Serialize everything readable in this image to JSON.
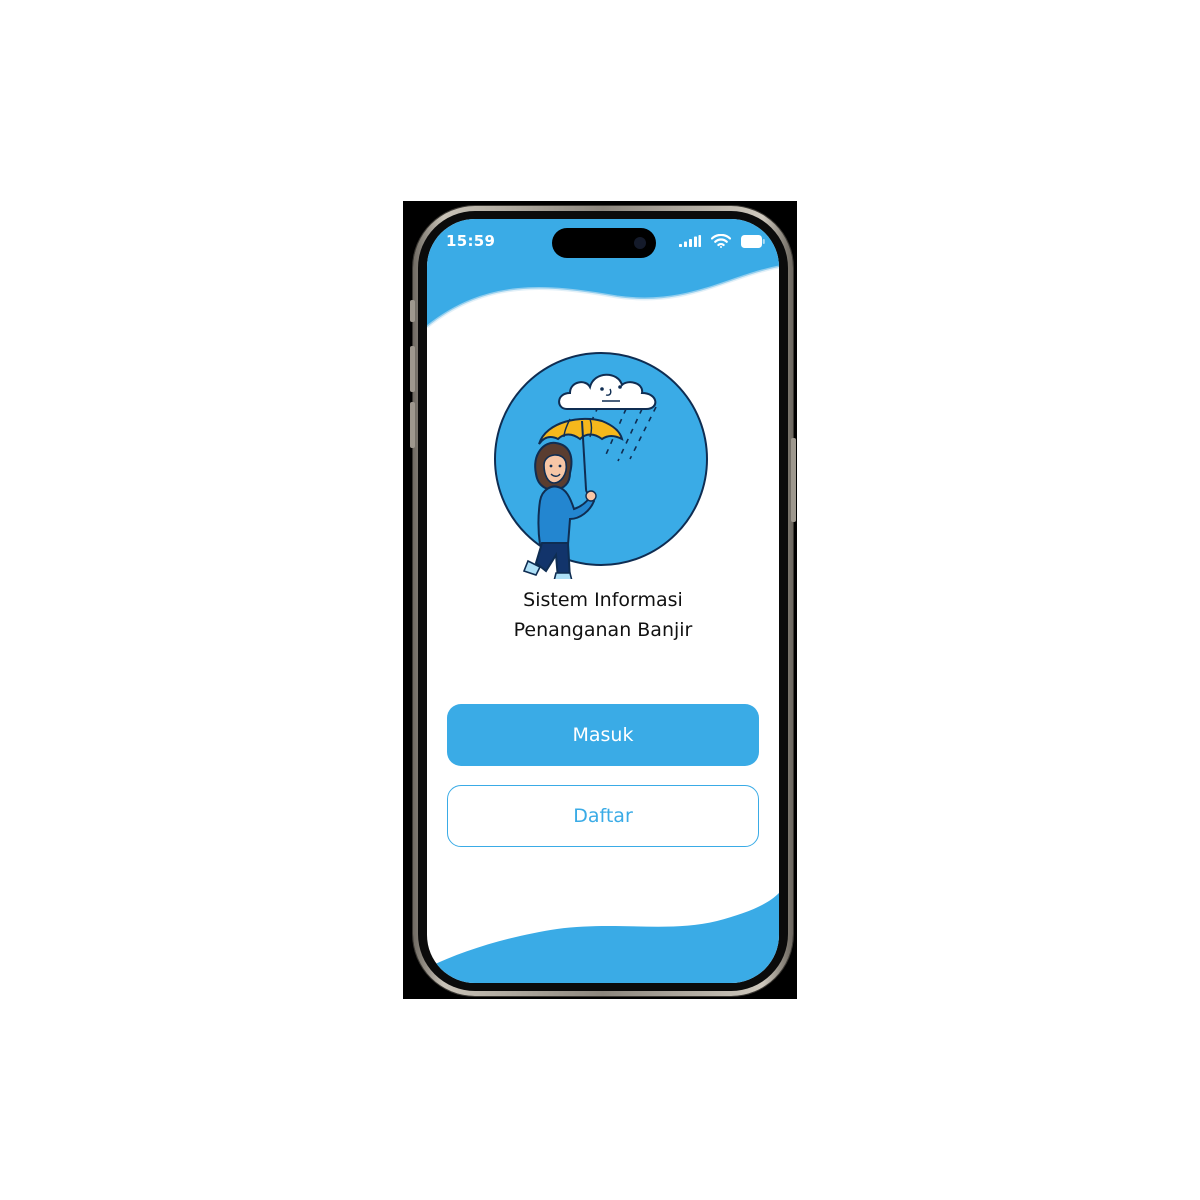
{
  "colors": {
    "accent": "#3aabe6",
    "text": "#111111",
    "background": "#ffffff"
  },
  "status_bar": {
    "time": "15:59",
    "icons": [
      "signal-bars-icon",
      "wifi-icon",
      "battery-icon"
    ]
  },
  "illustration": {
    "icon": "person-with-umbrella-in-rain-illustration"
  },
  "app": {
    "title_line1": "Sistem Informasi",
    "title_line2": "Penanganan Banjir"
  },
  "actions": {
    "login_label": "Masuk",
    "register_label": "Daftar"
  }
}
